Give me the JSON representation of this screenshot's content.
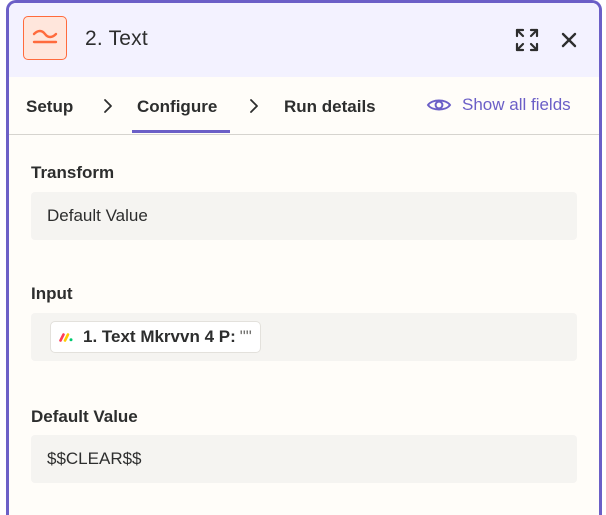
{
  "header": {
    "title": "2. Text",
    "app_icon": "formatter-squiggle-icon",
    "accent": "#ff6b3d"
  },
  "tabs": [
    {
      "label": "Setup"
    },
    {
      "label": "Configure",
      "active": true
    },
    {
      "label": "Run details"
    }
  ],
  "show_all_fields": "Show all fields",
  "colors": {
    "accent": "#6b5fc7",
    "text": "#2d2e2e",
    "field_bg": "#f5f4f1"
  },
  "fields": {
    "transform": {
      "label": "Transform",
      "value": "Default Value"
    },
    "input": {
      "label": "Input",
      "pill_text": "1. Text Mkrvvn 4 P:",
      "pill_value": "\"\""
    },
    "default_value": {
      "label": "Default Value",
      "value": "$$CLEAR$$"
    }
  }
}
